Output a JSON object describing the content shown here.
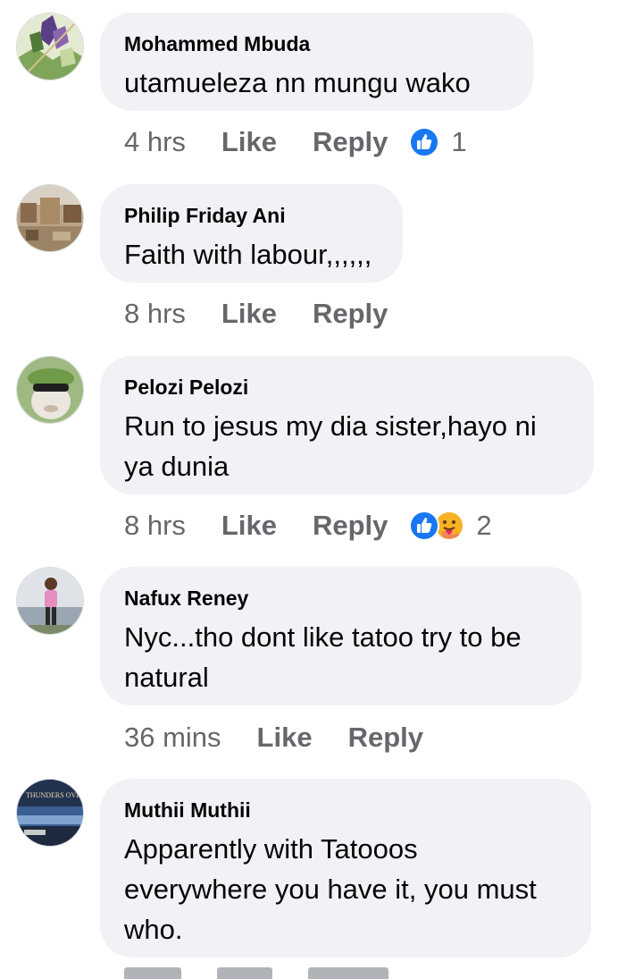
{
  "comments": [
    {
      "author": "Mohammed Mbuda",
      "text": "utamueleza nn mungu wako",
      "time": "4 hrs",
      "like": "Like",
      "reply": "Reply",
      "reaction_count": "1",
      "reactions": [
        "like-icon"
      ]
    },
    {
      "author": "Philip Friday Ani",
      "text": "Faith with labour,,,,,,",
      "time": "8 hrs",
      "like": "Like",
      "reply": "Reply"
    },
    {
      "author": "Pelozi Pelozi",
      "text": "Run to jesus my dia sister,hayo ni ya dunia",
      "time": "8 hrs",
      "like": "Like",
      "reply": "Reply",
      "reaction_count": "2",
      "reactions": [
        "like-icon",
        "care-icon"
      ]
    },
    {
      "author": "Nafux Reney",
      "text": "Nyc...tho dont like tatoo try to be natural",
      "time": "36 mins",
      "like": "Like",
      "reply": "Reply"
    },
    {
      "author": "Muthii Muthii",
      "text": "Apparently with Tatooos everywhere you have it, you must who.",
      "avatar_text": "THUNDERS OVER"
    }
  ],
  "colors": {
    "bubble": "#f0f2f5",
    "meta": "#65676b",
    "like_blue": "#1877f2",
    "care_yellow": "#f7b125"
  }
}
